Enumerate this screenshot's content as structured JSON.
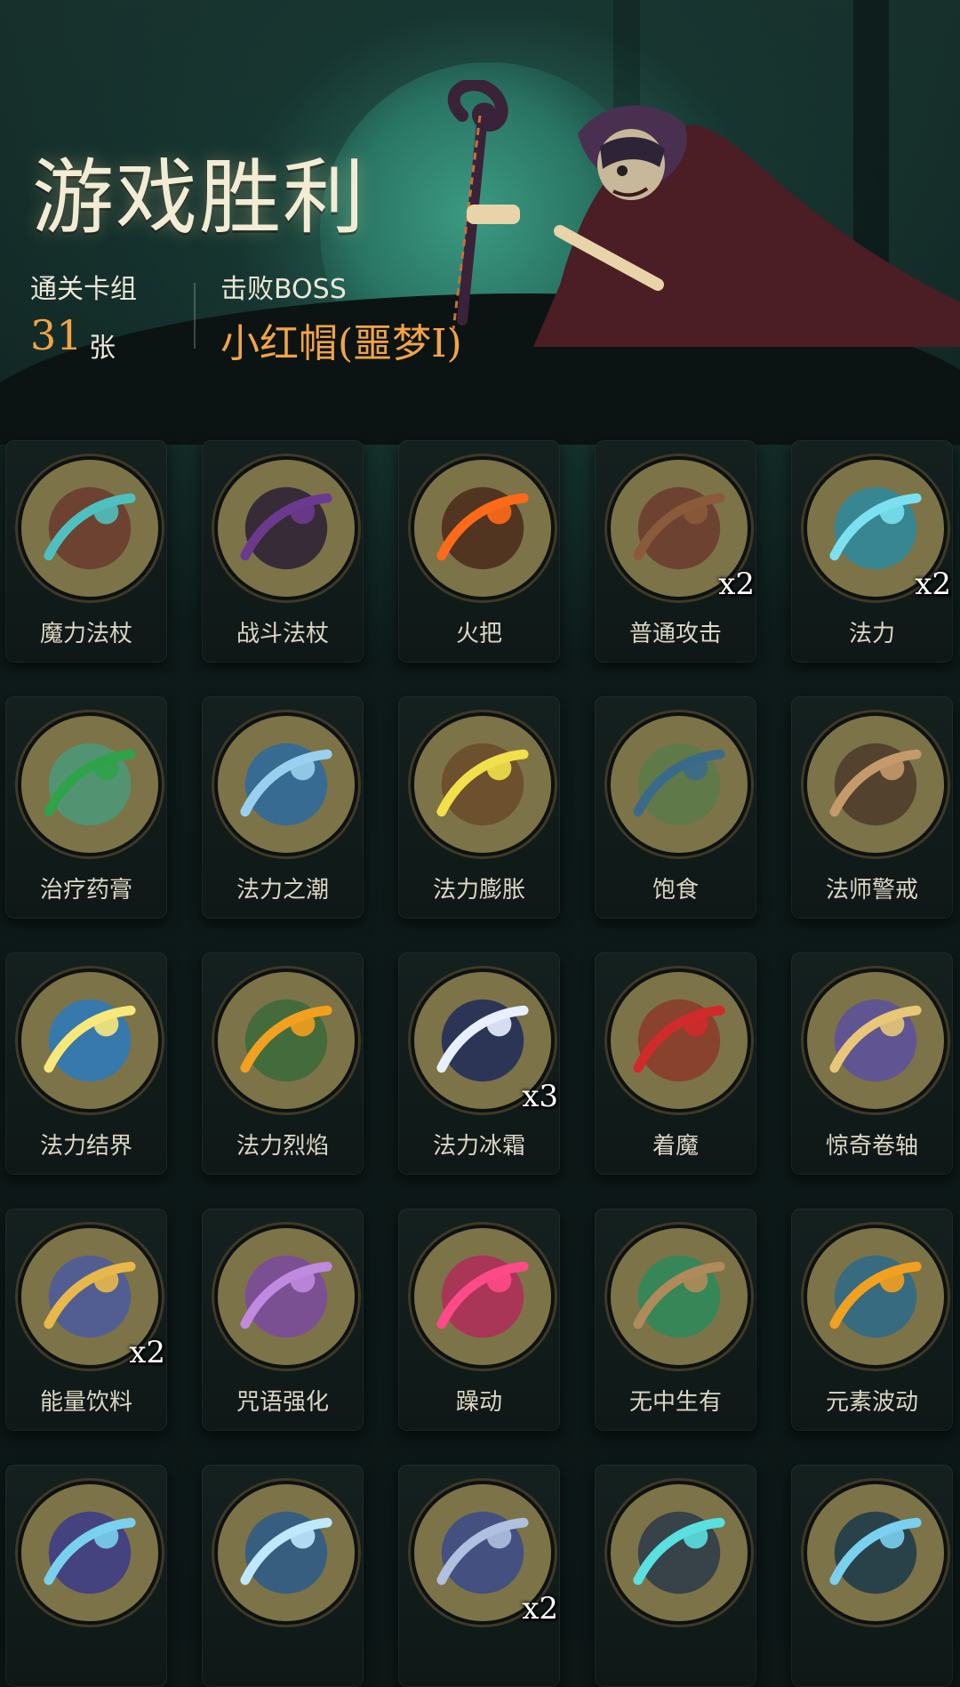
{
  "title": "游戏胜利",
  "stats": {
    "deck_label": "通关卡组",
    "deck_count": "31",
    "deck_unit": "张",
    "boss_label": "击败BOSS",
    "boss_name": "小红帽(噩梦I)"
  },
  "cards": [
    {
      "name": "魔力法杖",
      "count": "",
      "icon": "magic-staff-icon",
      "color": "#6b3a2e",
      "accent": "#4fc0c0"
    },
    {
      "name": "战斗法杖",
      "count": "",
      "icon": "battle-staff-icon",
      "color": "#2a1e35",
      "accent": "#6b3a8e"
    },
    {
      "name": "火把",
      "count": "",
      "icon": "torch-icon",
      "color": "#4a2a1a",
      "accent": "#ff6a1a"
    },
    {
      "name": "普通攻击",
      "count": "x2",
      "icon": "attack-staff-icon",
      "color": "#6b3a2e",
      "accent": "#8a5a3a"
    },
    {
      "name": "法力",
      "count": "x2",
      "icon": "mana-orb-icon",
      "color": "#2a8aa0",
      "accent": "#7be0ef"
    },
    {
      "name": "治疗药膏",
      "count": "",
      "icon": "healing-ointment-icon",
      "color": "#4a9a7a",
      "accent": "#2fa24a"
    },
    {
      "name": "法力之潮",
      "count": "",
      "icon": "mana-tide-icon",
      "color": "#2a6aa0",
      "accent": "#9ad0ef"
    },
    {
      "name": "法力膨胀",
      "count": "",
      "icon": "mana-surge-icon",
      "color": "#6a4a2a",
      "accent": "#f2e04a"
    },
    {
      "name": "饱食",
      "count": "",
      "icon": "satiated-icon",
      "color": "#5a7a4a",
      "accent": "#3a6a8a"
    },
    {
      "name": "法师警戒",
      "count": "",
      "icon": "mage-vigilance-icon",
      "color": "#4a3a2a",
      "accent": "#c49a6a"
    },
    {
      "name": "法力结界",
      "count": "",
      "icon": "mana-barrier-icon",
      "color": "#2a7ac0",
      "accent": "#f8e87a"
    },
    {
      "name": "法力烈焰",
      "count": "",
      "icon": "mana-flame-icon",
      "color": "#3a6a3a",
      "accent": "#f2a020"
    },
    {
      "name": "法力冰霜",
      "count": "x3",
      "icon": "mana-frost-icon",
      "color": "#1e2a5a",
      "accent": "#e8f0ff"
    },
    {
      "name": "着魔",
      "count": "",
      "icon": "possessed-icon",
      "color": "#8a3a2a",
      "accent": "#d02a2a"
    },
    {
      "name": "惊奇卷轴",
      "count": "",
      "icon": "scroll-icon",
      "color": "#5a50a0",
      "accent": "#e8c878"
    },
    {
      "name": "能量饮料",
      "count": "x2",
      "icon": "energy-drink-icon",
      "color": "#4a5aa0",
      "accent": "#e8b84a"
    },
    {
      "name": "咒语强化",
      "count": "",
      "icon": "spell-boost-icon",
      "color": "#7a4aa0",
      "accent": "#c08ae0"
    },
    {
      "name": "躁动",
      "count": "",
      "icon": "frenzy-icon",
      "color": "#b02a5a",
      "accent": "#ff4a8a"
    },
    {
      "name": "无中生有",
      "count": "",
      "icon": "something-from-nothing-icon",
      "color": "#2a8a5a",
      "accent": "#b08a5a"
    },
    {
      "name": "元素波动",
      "count": "",
      "icon": "elemental-wave-icon",
      "color": "#2a6a8a",
      "accent": "#f2a020"
    },
    {
      "name": "",
      "count": "",
      "icon": "tornado-icon",
      "color": "#3a3a8a",
      "accent": "#7ad0ef"
    },
    {
      "name": "",
      "count": "",
      "icon": "crystal-shield-icon",
      "color": "#2a5a8a",
      "accent": "#bfe8ff"
    },
    {
      "name": "",
      "count": "x2",
      "icon": "ghoul-icon",
      "color": "#3a4a8a",
      "accent": "#b0c0e0"
    },
    {
      "name": "",
      "count": "",
      "icon": "storm-cloud-icon",
      "color": "#2a3a4a",
      "accent": "#5ae0e0"
    },
    {
      "name": "",
      "count": "",
      "icon": "ice-spike-icon",
      "color": "#1a3a4a",
      "accent": "#7ad0ef"
    }
  ]
}
